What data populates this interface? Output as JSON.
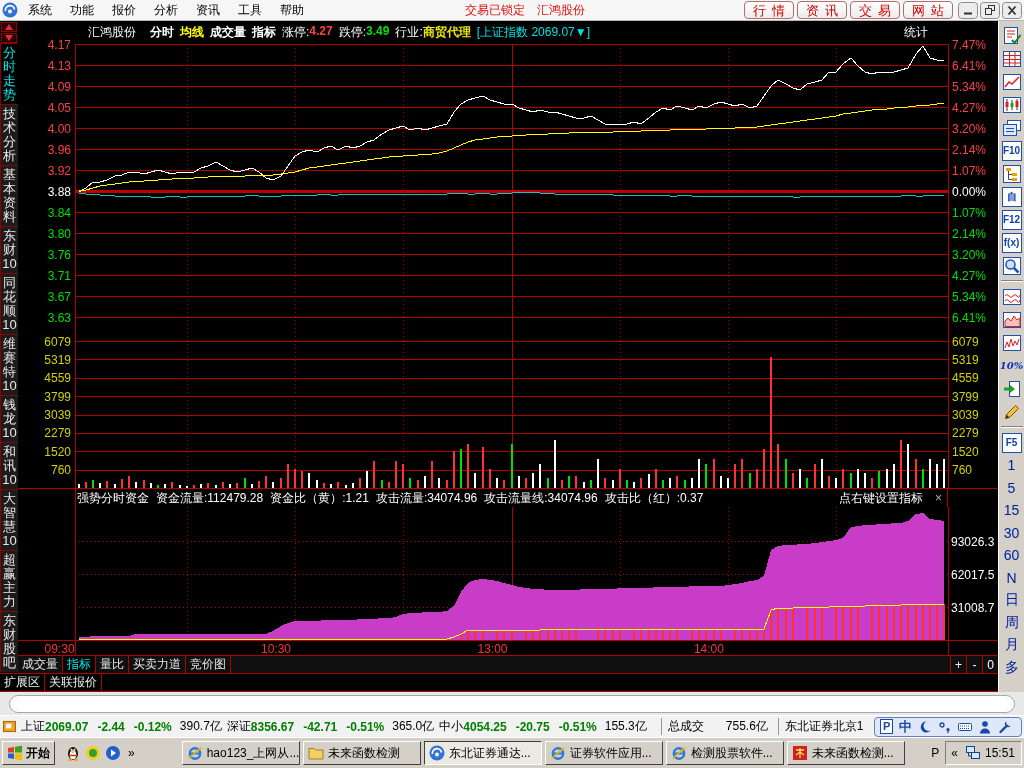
{
  "menubar": {
    "items": [
      "系统",
      "功能",
      "报价",
      "分析",
      "资讯",
      "工具",
      "帮助"
    ],
    "notices": [
      "交易已锁定",
      "汇鸿股份"
    ],
    "buttons": [
      "行情",
      "资讯",
      "交易",
      "网站"
    ]
  },
  "side_tabs": [
    {
      "label": "分时走势",
      "selected": true
    },
    {
      "label": "技术分析",
      "selected": false
    },
    {
      "label": "基本资料",
      "selected": false
    },
    {
      "label": "东财10",
      "selected": false
    },
    {
      "label": "同花顺10",
      "selected": false
    },
    {
      "label": "维赛特10",
      "selected": false
    },
    {
      "label": "钱龙10",
      "selected": false
    },
    {
      "label": "和讯10",
      "selected": false
    },
    {
      "label": "大智慧10",
      "selected": false
    },
    {
      "label": "超赢主力",
      "selected": false
    },
    {
      "label": "东财股吧",
      "selected": false
    }
  ],
  "quote_header": {
    "name": "汇鸿股份",
    "toggles": [
      {
        "label": "分时",
        "color": "#ffffff"
      },
      {
        "label": "均线",
        "color": "#ffff00"
      },
      {
        "label": "成交量",
        "color": "#ffffff"
      },
      {
        "label": "指标",
        "color": "#ffffff"
      }
    ],
    "fields": [
      {
        "label": "涨停:",
        "value": "4.27",
        "color": "#ff4040"
      },
      {
        "label": "跌停:",
        "value": "3.49",
        "color": "#00e000"
      },
      {
        "label": "行业:",
        "value": "商贸代理",
        "color": "#e8e800"
      }
    ],
    "index_link": "[上证指数 2069.07▼]",
    "stats_button": "统计"
  },
  "price_panel": {
    "percent_labels": [
      "7.47%",
      "6.41%",
      "5.34%",
      "4.27%",
      "3.20%",
      "2.14%",
      "1.07%",
      "0.00%",
      "1.07%",
      "2.14%",
      "3.20%",
      "4.27%",
      "5.34%",
      "6.41%"
    ],
    "chart_data": {
      "type": "line",
      "grid": true,
      "ylim": [
        3.586,
        4.1701
      ],
      "yticks": [
        {
          "value": 4.1701,
          "label": "4.17"
        },
        {
          "value": 4.1287,
          "label": "4.13"
        },
        {
          "value": 4.0872,
          "label": "4.09"
        },
        {
          "value": 4.0458,
          "label": "4.05"
        },
        {
          "value": 4.0043,
          "label": "4.00"
        },
        {
          "value": 3.9629,
          "label": "3.96"
        },
        {
          "value": 3.9214,
          "label": "3.92"
        },
        {
          "value": 3.88,
          "label": "3.88"
        },
        {
          "value": 3.8386,
          "label": "3.84"
        },
        {
          "value": 3.7971,
          "label": "3.80"
        },
        {
          "value": 3.7557,
          "label": "3.76"
        },
        {
          "value": 3.7142,
          "label": "3.71"
        },
        {
          "value": 3.6728,
          "label": "3.67"
        },
        {
          "value": 3.6313,
          "label": "3.63"
        }
      ],
      "ref_lines": [
        {
          "axis": "y",
          "value": 3.88
        }
      ],
      "series": [
        {
          "color": "#ffffff",
          "values": [
            3.878,
            3.886,
            3.898,
            3.898,
            3.902,
            3.91,
            3.912,
            3.917,
            3.917,
            3.914,
            3.917,
            3.921,
            3.917,
            3.914,
            3.917,
            3.917,
            3.917,
            3.925,
            3.929,
            3.937,
            3.929,
            3.921,
            3.917,
            3.921,
            3.925,
            3.917,
            3.906,
            3.902,
            3.91,
            3.929,
            3.949,
            3.957,
            3.961,
            3.957,
            3.965,
            3.969,
            3.961,
            3.969,
            3.965,
            3.969,
            3.977,
            3.981,
            3.992,
            4.0,
            4.004,
            4.008,
            4.0,
            4.004,
            4.0,
            4.004,
            4.008,
            4.012,
            4.036,
            4.052,
            4.06,
            4.064,
            4.067,
            4.06,
            4.056,
            4.052,
            4.052,
            4.044,
            4.04,
            4.036,
            4.04,
            4.036,
            4.036,
            4.032,
            4.028,
            4.024,
            4.024,
            4.028,
            4.02,
            4.012,
            4.012,
            4.012,
            4.012,
            4.016,
            4.012,
            4.024,
            4.036,
            4.044,
            4.04,
            4.048,
            4.044,
            4.04,
            4.048,
            4.044,
            4.052,
            4.056,
            4.052,
            4.048,
            4.052,
            4.044,
            4.048,
            4.067,
            4.087,
            4.099,
            4.091,
            4.083,
            4.079,
            4.091,
            4.095,
            4.099,
            4.115,
            4.115,
            4.131,
            4.142,
            4.127,
            4.115,
            4.111,
            4.115,
            4.115,
            4.115,
            4.119,
            4.123,
            4.15,
            4.166,
            4.142,
            4.138,
            4.138
          ]
        },
        {
          "color": "#ffff00",
          "values": [
            3.88,
            3.882,
            3.886,
            3.89,
            3.892,
            3.894,
            3.896,
            3.898,
            3.9,
            3.9,
            3.902,
            3.902,
            3.904,
            3.904,
            3.906,
            3.906,
            3.906,
            3.908,
            3.908,
            3.91,
            3.91,
            3.91,
            3.91,
            3.91,
            3.912,
            3.912,
            3.912,
            3.912,
            3.914,
            3.916,
            3.917,
            3.921,
            3.925,
            3.927,
            3.929,
            3.931,
            3.933,
            3.935,
            3.937,
            3.939,
            3.941,
            3.943,
            3.945,
            3.947,
            3.949,
            3.949,
            3.951,
            3.951,
            3.953,
            3.953,
            3.955,
            3.959,
            3.965,
            3.971,
            3.977,
            3.981,
            3.983,
            3.985,
            3.987,
            3.989,
            3.989,
            3.991,
            3.991,
            3.993,
            3.993,
            3.993,
            3.995,
            3.995,
            3.995,
            3.997,
            3.997,
            3.997,
            3.997,
            3.997,
            3.997,
            3.999,
            3.999,
            3.999,
            3.999,
            4.001,
            4.001,
            4.001,
            4.001,
            4.003,
            4.003,
            4.003,
            4.003,
            4.003,
            4.005,
            4.005,
            4.005,
            4.005,
            4.007,
            4.007,
            4.007,
            4.009,
            4.011,
            4.013,
            4.015,
            4.017,
            4.019,
            4.021,
            4.023,
            4.025,
            4.027,
            4.029,
            4.031,
            4.033,
            4.035,
            4.037,
            4.039,
            4.041,
            4.041,
            4.043,
            4.045,
            4.045,
            4.047,
            4.049,
            4.049,
            4.051,
            4.053
          ]
        },
        {
          "color": "#00c8c8",
          "values": [
            3.876,
            3.875,
            3.874,
            3.873,
            3.872,
            3.871,
            3.87,
            3.87,
            3.871,
            3.87,
            3.869,
            3.868,
            3.869,
            3.87,
            3.869,
            3.869,
            3.87,
            3.871,
            3.87,
            3.871,
            3.87,
            3.869,
            3.87,
            3.871,
            3.872,
            3.871,
            3.871,
            3.87,
            3.871,
            3.872,
            3.873,
            3.872,
            3.872,
            3.873,
            3.874,
            3.873,
            3.873,
            3.874,
            3.873,
            3.874,
            3.874,
            3.873,
            3.874,
            3.874,
            3.875,
            3.874,
            3.874,
            3.873,
            3.874,
            3.875,
            3.874,
            3.875,
            3.876,
            3.876,
            3.875,
            3.875,
            3.876,
            3.875,
            3.875,
            3.876,
            3.876,
            3.878,
            3.879,
            3.878,
            3.877,
            3.876,
            3.875,
            3.875,
            3.874,
            3.875,
            3.874,
            3.873,
            3.874,
            3.874,
            3.873,
            3.873,
            3.872,
            3.873,
            3.872,
            3.872,
            3.871,
            3.872,
            3.871,
            3.871,
            3.872,
            3.871,
            3.87,
            3.871,
            3.871,
            3.87,
            3.871,
            3.87,
            3.87,
            3.871,
            3.87,
            3.87,
            3.871,
            3.87,
            3.87,
            3.869,
            3.869,
            3.87,
            3.87,
            3.869,
            3.87,
            3.87,
            3.871,
            3.87,
            3.87,
            3.871,
            3.87,
            3.871,
            3.871,
            3.87,
            3.871,
            3.872,
            3.871,
            3.871,
            3.872,
            3.872,
            3.872
          ]
        }
      ]
    }
  },
  "volume_panel": {
    "right_labels": [
      "6079",
      "5319",
      "4559",
      "3799",
      "3039",
      "2279",
      "1520",
      "760"
    ],
    "chart_data": {
      "type": "bar",
      "grid": true,
      "ylim": [
        0,
        6079
      ],
      "yticks": [
        6079,
        5319,
        4559,
        3799,
        3039,
        2279,
        1520,
        760
      ],
      "series": [
        {
          "color": "#ff3232",
          "values": [
            0,
            240,
            0,
            0,
            280,
            0,
            360,
            480,
            0,
            320,
            0,
            0,
            0,
            240,
            0,
            0,
            120,
            0,
            200,
            0,
            240,
            0,
            200,
            0,
            0,
            280,
            480,
            0,
            400,
            1000,
            800,
            720,
            0,
            0,
            200,
            0,
            240,
            0,
            0,
            400,
            0,
            1120,
            0,
            240,
            1120,
            1000,
            0,
            320,
            0,
            1120,
            0,
            320,
            1520,
            0,
            1800,
            0,
            1680,
            800,
            0,
            320,
            0,
            0,
            400,
            0,
            0,
            0,
            0,
            320,
            0,
            480,
            0,
            0,
            0,
            400,
            0,
            800,
            0,
            0,
            400,
            0,
            800,
            0,
            0,
            480,
            0,
            0,
            0,
            0,
            1200,
            0,
            0,
            1000,
            1200,
            0,
            800,
            1600,
            5400,
            1800,
            0,
            600,
            0,
            0,
            1000,
            0,
            480,
            0,
            800,
            0,
            0,
            0,
            400,
            0,
            0,
            0,
            2000,
            0,
            1200,
            0,
            0,
            0,
            0
          ]
        },
        {
          "color": "#00e000",
          "values": [
            0,
            0,
            320,
            0,
            0,
            0,
            0,
            0,
            0,
            0,
            0,
            120,
            0,
            0,
            0,
            0,
            0,
            0,
            0,
            0,
            0,
            0,
            0,
            400,
            0,
            0,
            0,
            0,
            0,
            0,
            0,
            0,
            0,
            0,
            0,
            0,
            0,
            0,
            0,
            0,
            0,
            0,
            320,
            0,
            0,
            0,
            400,
            0,
            0,
            0,
            0,
            0,
            0,
            1600,
            0,
            0,
            0,
            0,
            0,
            0,
            1800,
            0,
            0,
            0,
            0,
            400,
            0,
            0,
            480,
            0,
            0,
            320,
            0,
            0,
            0,
            0,
            320,
            0,
            0,
            0,
            0,
            320,
            0,
            0,
            320,
            0,
            0,
            1000,
            0,
            0,
            0,
            0,
            0,
            600,
            0,
            0,
            0,
            0,
            1200,
            0,
            0,
            400,
            0,
            0,
            0,
            0,
            0,
            600,
            0,
            0,
            0,
            720,
            0,
            0,
            0,
            0,
            0,
            800,
            0,
            0,
            0
          ]
        },
        {
          "color": "#ffffff",
          "values": [
            160,
            0,
            0,
            200,
            0,
            160,
            0,
            0,
            240,
            0,
            200,
            0,
            160,
            0,
            120,
            80,
            0,
            160,
            0,
            120,
            0,
            160,
            0,
            0,
            160,
            0,
            0,
            240,
            0,
            0,
            0,
            0,
            600,
            320,
            0,
            160,
            0,
            120,
            200,
            0,
            720,
            0,
            0,
            0,
            0,
            0,
            0,
            0,
            480,
            0,
            400,
            0,
            0,
            0,
            0,
            600,
            0,
            0,
            400,
            0,
            0,
            480,
            0,
            600,
            1000,
            0,
            2000,
            0,
            0,
            0,
            240,
            0,
            1200,
            0,
            320,
            0,
            0,
            240,
            0,
            560,
            0,
            0,
            400,
            0,
            0,
            400,
            1200,
            0,
            0,
            480,
            400,
            0,
            0,
            0,
            0,
            0,
            0,
            0,
            0,
            0,
            800,
            0,
            0,
            1200,
            0,
            400,
            0,
            0,
            800,
            600,
            0,
            0,
            800,
            1000,
            0,
            1800,
            0,
            0,
            1200,
            1000,
            1200
          ]
        }
      ]
    }
  },
  "indicator_panel": {
    "title": "强势分时资金",
    "readings": [
      "资金流量:112479.28",
      "资金比（黄）:1.21",
      "攻击流量:34074.96",
      "攻击流量线:34074.96",
      "攻击比（红）:0.37"
    ],
    "hint": "点右键设置指标",
    "close": "×",
    "chart_data": {
      "type": "area",
      "grid": true,
      "ylim": [
        0,
        125000
      ],
      "yticks": [
        93026.3,
        62017.5,
        31008.7
      ],
      "series": [
        {
          "type": "area",
          "color": "#c83cc8",
          "values": [
            3000,
            3000,
            4000,
            4000,
            4000,
            4000,
            4000,
            4000,
            6000,
            6000,
            6000,
            6000,
            6000,
            6000,
            6000,
            6000,
            6000,
            6000,
            6000,
            6000,
            6000,
            6000,
            6000,
            6000,
            6000,
            6000,
            6000,
            8000,
            13000,
            16000,
            18000,
            18000,
            18000,
            18000,
            19000,
            19000,
            19000,
            19000,
            19000,
            20000,
            20000,
            20000,
            21000,
            21000,
            22000,
            24000,
            25000,
            25000,
            26000,
            26000,
            26000,
            27000,
            32000,
            45000,
            54000,
            56000,
            57000,
            56000,
            55000,
            54000,
            52000,
            50000,
            49000,
            48000,
            48000,
            47000,
            47000,
            47000,
            47000,
            47000,
            48000,
            48000,
            48000,
            48000,
            48000,
            49000,
            49000,
            49000,
            49000,
            49000,
            50000,
            50000,
            50000,
            50000,
            50000,
            51000,
            51000,
            51000,
            51000,
            51000,
            52000,
            53000,
            54000,
            55000,
            56000,
            60000,
            85000,
            88000,
            89000,
            89000,
            90000,
            90000,
            91000,
            92000,
            93000,
            94000,
            96000,
            106000,
            107000,
            108000,
            108000,
            109000,
            109000,
            110000,
            110000,
            112000,
            118000,
            119000,
            114000,
            113000,
            112000
          ]
        },
        {
          "type": "bar",
          "color": "#ff3030",
          "values": [
            0,
            0,
            0,
            0,
            0,
            0,
            0,
            0,
            0,
            0,
            0,
            0,
            0,
            0,
            0,
            0,
            0,
            0,
            0,
            0,
            0,
            0,
            0,
            0,
            0,
            0,
            0,
            0,
            0,
            0,
            0,
            0,
            0,
            0,
            0,
            0,
            0,
            0,
            0,
            0,
            0,
            0,
            0,
            0,
            0,
            0,
            0,
            0,
            0,
            0,
            0,
            0,
            0,
            6000,
            9000,
            9000,
            9000,
            0,
            9000,
            9000,
            9000,
            0,
            9000,
            9000,
            9000,
            10000,
            10000,
            10000,
            10000,
            10000,
            0,
            0,
            10000,
            10000,
            10000,
            10000,
            0,
            10000,
            10000,
            10000,
            10000,
            10000,
            10000,
            10000,
            0,
            10000,
            10000,
            10000,
            10000,
            10000,
            0,
            10000,
            10000,
            10000,
            10000,
            10000,
            28000,
            30000,
            30000,
            30000,
            0,
            31000,
            31000,
            31000,
            0,
            32000,
            32000,
            32000,
            32000,
            0,
            33000,
            33000,
            33000,
            33000,
            33000,
            34000,
            34000,
            34000,
            34000,
            34000,
            34000
          ]
        },
        {
          "type": "line",
          "color": "#ffff00",
          "values": [
            1000,
            1000,
            1000,
            1000,
            1000,
            1000,
            1000,
            1000,
            1000,
            1000,
            1000,
            1000,
            1000,
            1000,
            1000,
            1000,
            1000,
            1000,
            1000,
            1000,
            1000,
            1000,
            1000,
            1000,
            1000,
            1000,
            1000,
            1000,
            1000,
            1000,
            1000,
            1000,
            1000,
            1000,
            1000,
            1000,
            1000,
            1000,
            1000,
            1000,
            1000,
            1000,
            1000,
            1000,
            1000,
            1000,
            1000,
            1000,
            1000,
            1000,
            1000,
            1000,
            3000,
            6000,
            9000,
            9000,
            9000,
            9000,
            9000,
            9000,
            9000,
            9000,
            9000,
            9000,
            9000,
            10000,
            10000,
            10000,
            10000,
            10000,
            10000,
            10000,
            10000,
            10000,
            10000,
            10000,
            10000,
            10000,
            10000,
            10000,
            10000,
            10000,
            10000,
            10000,
            10000,
            10000,
            10000,
            10000,
            10000,
            10000,
            10000,
            10000,
            10000,
            10000,
            10000,
            10000,
            28000,
            30000,
            30000,
            30000,
            31000,
            31000,
            31000,
            31000,
            31000,
            32000,
            32000,
            32000,
            32000,
            32000,
            33000,
            33000,
            33000,
            33000,
            33000,
            34000,
            34000,
            34000,
            34000,
            34000,
            34000
          ]
        }
      ]
    },
    "time_axis": [
      "09:30",
      "10:30",
      "13:00",
      "14:00"
    ]
  },
  "bottom_tabs": [
    {
      "label": "成交量",
      "selected": false
    },
    {
      "label": "指标",
      "selected": true
    },
    {
      "label": "量比",
      "selected": false
    },
    {
      "label": "买卖力道",
      "selected": false
    },
    {
      "label": "竞价图",
      "selected": false
    }
  ],
  "zoom_buttons": [
    "+",
    "-",
    "0"
  ],
  "extension_tabs": [
    "扩展区",
    "关联报价"
  ],
  "right_toolbar": [
    {
      "kind": "icon"
    },
    {
      "kind": "icon"
    },
    {
      "kind": "icon"
    },
    {
      "kind": "icon"
    },
    {
      "kind": "icon"
    },
    {
      "kind": "tile",
      "label": "F10"
    },
    {
      "kind": "icon"
    },
    {
      "kind": "tile",
      "label": "自"
    },
    {
      "kind": "tile",
      "label": "F12"
    },
    {
      "kind": "tile",
      "label": "f(x)"
    },
    {
      "kind": "icon"
    },
    {
      "kind": "separator"
    },
    {
      "kind": "icon"
    },
    {
      "kind": "icon"
    },
    {
      "kind": "icon"
    },
    {
      "kind": "glyph",
      "label": "10%"
    },
    {
      "kind": "icon"
    },
    {
      "kind": "icon"
    },
    {
      "kind": "separator"
    },
    {
      "kind": "tile",
      "label": "F5"
    },
    {
      "kind": "text",
      "label": "1"
    },
    {
      "kind": "text",
      "label": "5"
    },
    {
      "kind": "text",
      "label": "15"
    },
    {
      "kind": "text",
      "label": "30"
    },
    {
      "kind": "text",
      "label": "60"
    },
    {
      "kind": "text",
      "label": "N"
    },
    {
      "kind": "text",
      "label": "日"
    },
    {
      "kind": "text",
      "label": "周"
    },
    {
      "kind": "text",
      "label": "月"
    },
    {
      "kind": "text",
      "label": "多"
    }
  ],
  "status_bar": {
    "indices": [
      {
        "name": "上证",
        "value": "2069.07",
        "change": "-2.44",
        "percent": "-0.12%",
        "amount": "390.7亿",
        "color": "#008000"
      },
      {
        "name": "深证",
        "value": "8356.67",
        "change": "-42.71",
        "percent": "-0.51%",
        "amount": "365.0亿",
        "color": "#008000"
      },
      {
        "name": "中小",
        "value": "4054.25",
        "change": "-20.75",
        "percent": "-0.51%",
        "amount": "155.3亿",
        "color": "#008000"
      }
    ],
    "total_label": "总成交",
    "total_value": "755.6亿",
    "broker": "东北证券北京1"
  },
  "ime_bar": {
    "logo": "P",
    "mode": "中"
  },
  "taskbar": {
    "start": "开始",
    "quick_launch_more": "»",
    "tasks": [
      {
        "label": "hao123_上网从...",
        "kind": "browser",
        "selected": false
      },
      {
        "label": "未来函数检测",
        "kind": "folder",
        "selected": false
      },
      {
        "label": "东北证券通达...",
        "kind": "app",
        "selected": true
      },
      {
        "label": "证券软件应用...",
        "kind": "browser",
        "selected": false
      },
      {
        "label": "检测股票软件...",
        "kind": "browser",
        "selected": false
      },
      {
        "label": "未来函数检测...",
        "kind": "document",
        "selected": false
      }
    ],
    "tray_logo": "P",
    "tray_more": "«",
    "clock": "15:51"
  }
}
